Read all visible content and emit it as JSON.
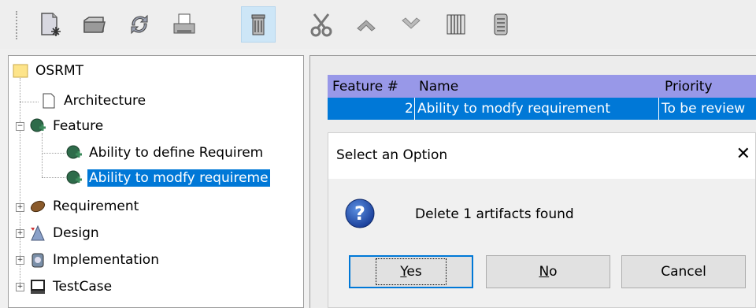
{
  "toolbar": {
    "items": [
      {
        "name": "new-document-icon"
      },
      {
        "name": "open-folder-icon"
      },
      {
        "name": "refresh-icon"
      },
      {
        "name": "print-icon"
      },
      {
        "name": "delete-icon",
        "active": true
      },
      {
        "name": "cut-icon"
      },
      {
        "name": "move-up-icon"
      },
      {
        "name": "move-down-icon"
      },
      {
        "name": "columns-icon"
      },
      {
        "name": "scroll-icon"
      }
    ]
  },
  "tree": {
    "root": "OSRMT",
    "architecture": "Architecture",
    "feature": "Feature",
    "feature_child_1": "Ability to define Requirem",
    "feature_child_2": "Ability to modfy requireme",
    "requirement": "Requirement",
    "design": "Design",
    "implementation": "Implementation",
    "testcase": "TestCase"
  },
  "table": {
    "headers": [
      "Feature #",
      "Name",
      "Priority"
    ],
    "row": [
      "2",
      "Ability to modfy requirement",
      "To be review"
    ]
  },
  "dialog": {
    "title": "Select an Option",
    "close": "✕",
    "message": "Delete 1 artifacts found",
    "yes_pre": "",
    "yes_u": "Y",
    "yes_post": "es",
    "no_u": "N",
    "no_post": "o",
    "cancel": "Cancel"
  },
  "colors": {
    "selection": "#0078d7",
    "table_header": "#9898e8"
  }
}
